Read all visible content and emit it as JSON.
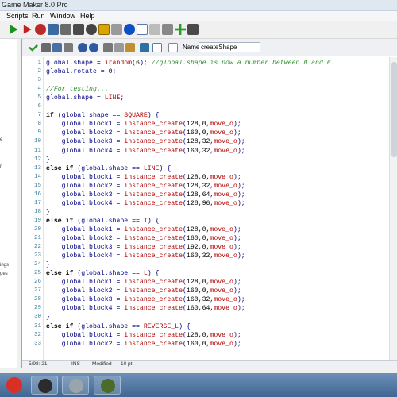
{
  "window": {
    "title": "Game Maker 8.0 Pro"
  },
  "menu": [
    "Scripts",
    "Run",
    "Window",
    "Help"
  ],
  "left_panel_fragments": [
    "e",
    "r",
    "ings",
    "ges"
  ],
  "script_editor": {
    "name_label": "Name:",
    "name_value": "createShape",
    "status": {
      "position": "5/98: 21",
      "mode": "INS",
      "modified": "Modified",
      "font": "10 pt"
    }
  },
  "code_lines": [
    {
      "n": "1",
      "t": "global.shape = irandom(6); //global.shape is now a number between 0 and 6."
    },
    {
      "n": "2",
      "t": "global.rotate = 0;"
    },
    {
      "n": "3",
      "t": ""
    },
    {
      "n": "4",
      "t": "//For testing..."
    },
    {
      "n": "5",
      "t": "global.shape = LINE;"
    },
    {
      "n": "6",
      "t": ""
    },
    {
      "n": "7",
      "t": "if (global.shape == SQUARE) {"
    },
    {
      "n": "8",
      "t": "    global.block1 = instance_create(128,0,move_o);"
    },
    {
      "n": "9",
      "t": "    global.block2 = instance_create(160,0,move_o);"
    },
    {
      "n": "10",
      "t": "    global.block3 = instance_create(128,32,move_o);"
    },
    {
      "n": "11",
      "t": "    global.block4 = instance_create(160,32,move_o);"
    },
    {
      "n": "12",
      "t": "}"
    },
    {
      "n": "13",
      "t": "else if (global.shape == LINE) {"
    },
    {
      "n": "14",
      "t": "    global.block1 = instance_create(128,0,move_o);"
    },
    {
      "n": "15",
      "t": "    global.block2 = instance_create(128,32,move_o);"
    },
    {
      "n": "16",
      "t": "    global.block3 = instance_create(128,64,move_o);"
    },
    {
      "n": "17",
      "t": "    global.block4 = instance_create(128,96,move_o);"
    },
    {
      "n": "18",
      "t": "}"
    },
    {
      "n": "19",
      "t": "else if (global.shape == T) {"
    },
    {
      "n": "20",
      "t": "    global.block1 = instance_create(128,0,move_o);"
    },
    {
      "n": "21",
      "t": "    global.block2 = instance_create(160,0,move_o);"
    },
    {
      "n": "22",
      "t": "    global.block3 = instance_create(192,0,move_o);"
    },
    {
      "n": "23",
      "t": "    global.block4 = instance_create(160,32,move_o);"
    },
    {
      "n": "24",
      "t": "}"
    },
    {
      "n": "25",
      "t": "else if (global.shape == L) {"
    },
    {
      "n": "26",
      "t": "    global.block1 = instance_create(128,0,move_o);"
    },
    {
      "n": "27",
      "t": "    global.block2 = instance_create(160,0,move_o);"
    },
    {
      "n": "28",
      "t": "    global.block3 = instance_create(160,32,move_o);"
    },
    {
      "n": "29",
      "t": "    global.block4 = instance_create(160,64,move_o);"
    },
    {
      "n": "30",
      "t": "}"
    },
    {
      "n": "31",
      "t": "else if (global.shape == REVERSE_L) {"
    },
    {
      "n": "32",
      "t": "    global.block1 = instance_create(128,0,move_o);"
    },
    {
      "n": "33",
      "t": "    global.block2 = instance_create(160,0,move_o);"
    }
  ],
  "taskbar": [
    {
      "name": "chrome",
      "color": "#d93025"
    },
    {
      "name": "game-maker",
      "color": "#2b2b2b"
    },
    {
      "name": "app",
      "color": "#9aa4ad"
    },
    {
      "name": "game",
      "color": "#4a6b2a"
    }
  ]
}
